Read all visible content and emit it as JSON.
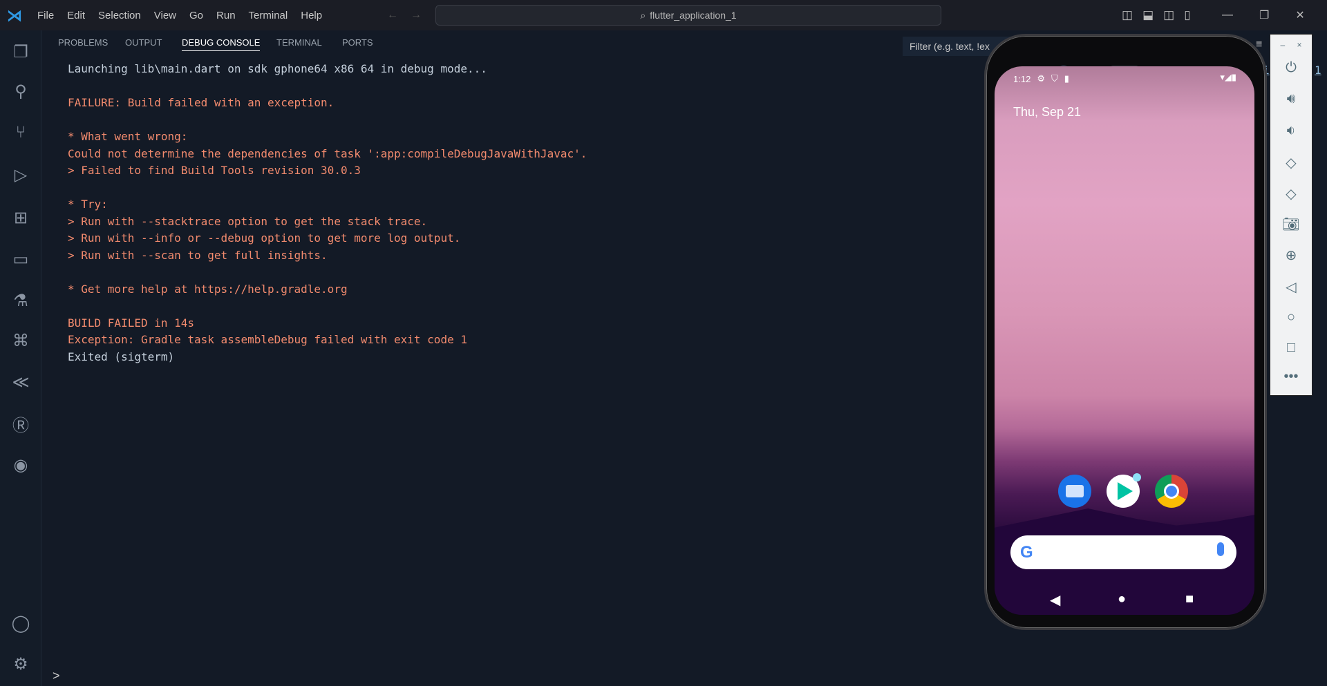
{
  "titlebar": {
    "menu": [
      "File",
      "Edit",
      "Selection",
      "View",
      "Go",
      "Run",
      "Terminal",
      "Help"
    ],
    "search": "flutter_application_1"
  },
  "panel": {
    "tabs": [
      "PROBLEMS",
      "OUTPUT",
      "DEBUG CONSOLE",
      "TERMINAL",
      "PORTS"
    ],
    "active_tab": "DEBUG CONSOLE",
    "filter_placeholder": "Filter (e.g. text, !ex",
    "right_fragments": [
      "i",
      "1"
    ]
  },
  "console": [
    {
      "text": "Launching lib\\main.dart on sdk gphone64 x86 64 in debug mode...",
      "type": "info"
    },
    {
      "text": "",
      "type": "info"
    },
    {
      "text": "FAILURE: Build failed with an exception.",
      "type": "err"
    },
    {
      "text": "",
      "type": "info"
    },
    {
      "text": "* What went wrong:",
      "type": "err"
    },
    {
      "text": "Could not determine the dependencies of task ':app:compileDebugJavaWithJavac'.",
      "type": "err"
    },
    {
      "text": "> Failed to find Build Tools revision 30.0.3",
      "type": "err"
    },
    {
      "text": "",
      "type": "info"
    },
    {
      "text": "* Try:",
      "type": "err"
    },
    {
      "text": "> Run with --stacktrace option to get the stack trace.",
      "type": "err"
    },
    {
      "text": "> Run with --info or --debug option to get more log output.",
      "type": "err"
    },
    {
      "text": "> Run with --scan to get full insights.",
      "type": "err"
    },
    {
      "text": "",
      "type": "info"
    },
    {
      "text": "* Get more help at https://help.gradle.org",
      "type": "err"
    },
    {
      "text": "",
      "type": "info"
    },
    {
      "text": "BUILD FAILED in 14s",
      "type": "err"
    },
    {
      "text": "Exception: Gradle task assembleDebug failed with exit code 1",
      "type": "err"
    },
    {
      "text": "Exited (sigterm)",
      "type": "info"
    }
  ],
  "bottom_prompt": ">",
  "phone": {
    "time": "1:12",
    "date": "Thu, Sep 21",
    "apps": [
      "messages-icon",
      "play-store-icon",
      "chrome-icon"
    ]
  },
  "colors": {
    "error": "#f38b6e",
    "info": "#c5d0dc",
    "background": "#131a26"
  }
}
